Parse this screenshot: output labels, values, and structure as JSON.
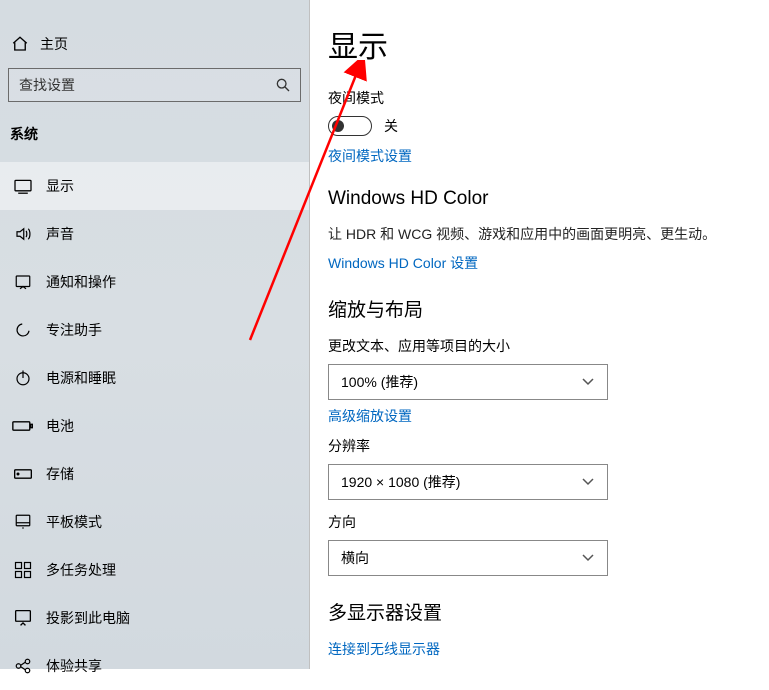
{
  "sidebar": {
    "home": "主页",
    "search_placeholder": "查找设置",
    "section": "系统",
    "items": [
      {
        "label": "显示"
      },
      {
        "label": "声音"
      },
      {
        "label": "通知和操作"
      },
      {
        "label": "专注助手"
      },
      {
        "label": "电源和睡眠"
      },
      {
        "label": "电池"
      },
      {
        "label": "存储"
      },
      {
        "label": "平板模式"
      },
      {
        "label": "多任务处理"
      },
      {
        "label": "投影到此电脑"
      },
      {
        "label": "体验共享"
      }
    ]
  },
  "content": {
    "title": "显示",
    "night_mode_label": "夜间模式",
    "toggle_state": "关",
    "night_mode_link": "夜间模式设置",
    "hd_color_heading": "Windows HD Color",
    "hd_color_desc": "让 HDR 和 WCG 视频、游戏和应用中的画面更明亮、更生动。",
    "hd_color_link": "Windows HD Color 设置",
    "scale_heading": "缩放与布局",
    "scale_label": "更改文本、应用等项目的大小",
    "scale_value": "100% (推荐)",
    "scale_link": "高级缩放设置",
    "resolution_label": "分辨率",
    "resolution_value": "1920 × 1080 (推荐)",
    "orientation_label": "方向",
    "orientation_value": "横向",
    "multi_display_heading": "多显示器设置",
    "wireless_link": "连接到无线显示器"
  }
}
